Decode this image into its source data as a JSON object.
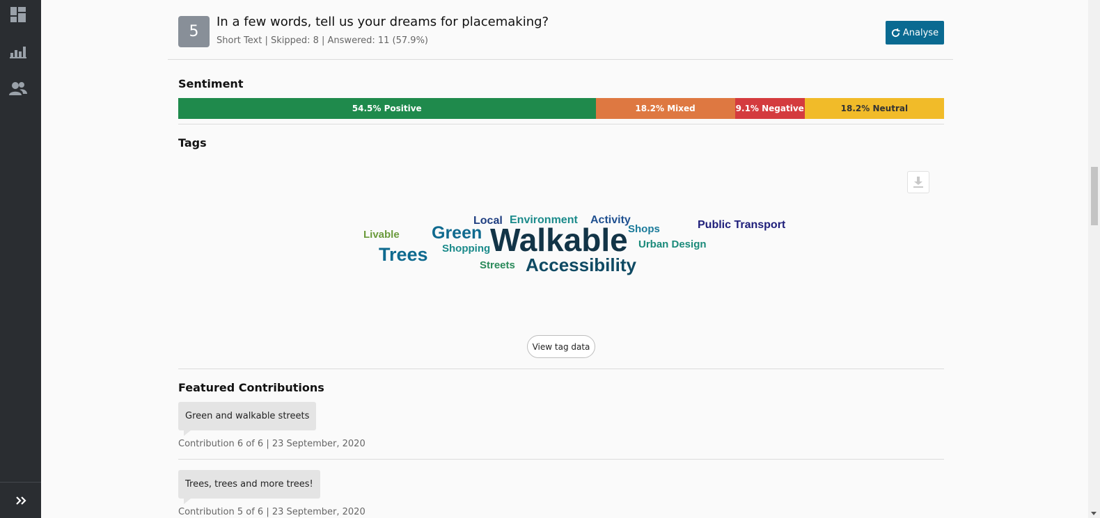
{
  "sidebar": {
    "icons": [
      "dashboard-icon",
      "bar-chart-icon",
      "users-icon"
    ],
    "expand_icon": "double-chevron-right-icon"
  },
  "question": {
    "number": "5",
    "title": "In a few words, tell us your dreams for placemaking?",
    "meta": "Short Text | Skipped: 8 | Answered: 11 (57.9%)",
    "analyse_label": "Analyse"
  },
  "sentiment": {
    "title": "Sentiment",
    "segments": [
      {
        "label": "54.5% Positive",
        "percent": 54.5,
        "color": "#1f8a4c"
      },
      {
        "label": "18.2% Mixed",
        "percent": 18.2,
        "color": "#de7841"
      },
      {
        "label": "9.1% Negative",
        "percent": 9.1,
        "color": "#d43b3e"
      },
      {
        "label": "18.2% Neutral",
        "percent": 18.2,
        "color": "#f1bb29"
      }
    ]
  },
  "tags": {
    "title": "Tags",
    "download_icon": "download-icon",
    "view_tag_data_label": "View tag data",
    "words": [
      {
        "text": "Walkable",
        "color": "#123447"
      },
      {
        "text": "Accessibility",
        "color": "#0f4a63"
      },
      {
        "text": "Trees",
        "color": "#0f6a8f"
      },
      {
        "text": "Green",
        "color": "#0f6a8f"
      },
      {
        "text": "Local",
        "color": "#1e3d80"
      },
      {
        "text": "Environment",
        "color": "#1a8a8a"
      },
      {
        "text": "Activity",
        "color": "#1e4f8f"
      },
      {
        "text": "Shops",
        "color": "#1a7a9a"
      },
      {
        "text": "Public Transport",
        "color": "#1e1e7a"
      },
      {
        "text": "Livable",
        "color": "#6b9a3c"
      },
      {
        "text": "Shopping",
        "color": "#1a8a8a"
      },
      {
        "text": "Urban Design",
        "color": "#1a8a7a"
      },
      {
        "text": "Streets",
        "color": "#2a8a5a"
      }
    ]
  },
  "featured": {
    "title": "Featured Contributions",
    "items": [
      {
        "text": "Green and walkable streets",
        "meta": "Contribution 6 of 6 | 23 September, 2020"
      },
      {
        "text": "Trees, trees and more trees!",
        "meta": "Contribution 5 of 6 | 23 September, 2020"
      }
    ]
  }
}
